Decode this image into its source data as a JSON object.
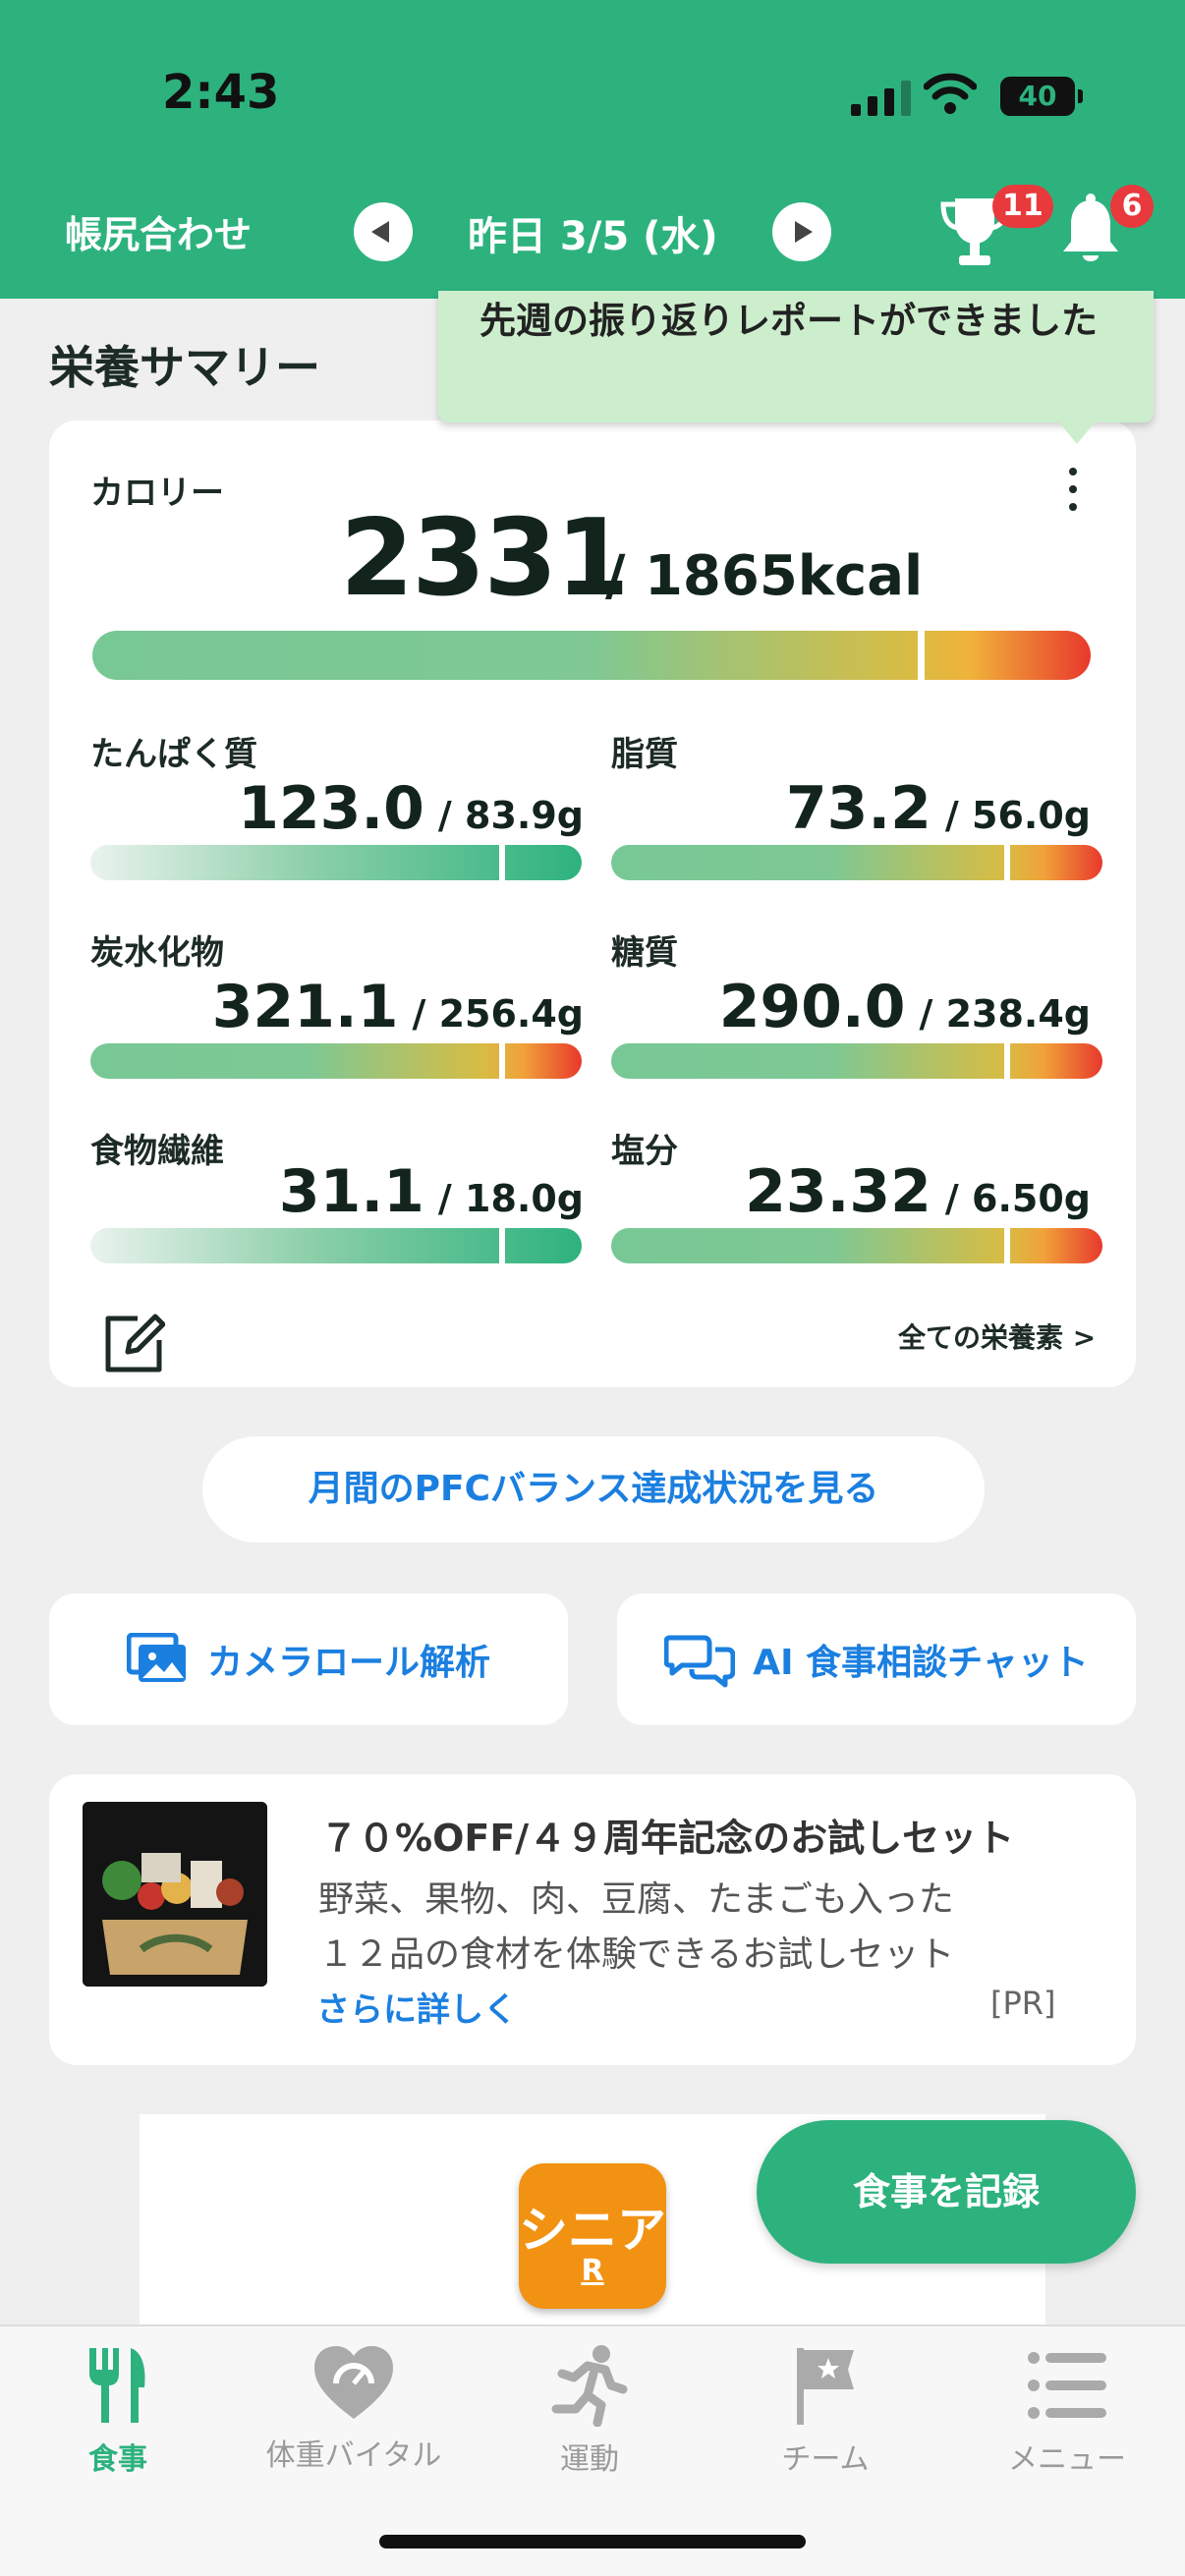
{
  "status_bar": {
    "time": "2:43",
    "battery": "40"
  },
  "header": {
    "left_label": "帳尻合わせ",
    "date": "昨日 3/5 (水)",
    "trophy_badge": "11",
    "bell_badge": "6",
    "bg_color": "#2db27e"
  },
  "tooltip": {
    "text": "先週の振り返りレポートができました"
  },
  "summary": {
    "title": "栄養サマリー",
    "calorie": {
      "label": "カロリー",
      "value": "2331",
      "target": "/ 1865kcal",
      "ratio": 1.25
    },
    "nutrients": [
      {
        "label": "たんぱく質",
        "value": "123.0",
        "target": "/ 83.9g",
        "ratio": 1.47,
        "status": "good"
      },
      {
        "label": "脂質",
        "value": "73.2",
        "target": "/ 56.0g",
        "ratio": 1.31,
        "status": "over"
      },
      {
        "label": "炭水化物",
        "value": "321.1",
        "target": "/ 256.4g",
        "ratio": 1.25,
        "status": "over"
      },
      {
        "label": "糖質",
        "value": "290.0",
        "target": "/ 238.4g",
        "ratio": 1.22,
        "status": "over"
      },
      {
        "label": "食物繊維",
        "value": "31.1",
        "target": "/ 18.0g",
        "ratio": 1.73,
        "status": "good"
      },
      {
        "label": "塩分",
        "value": "23.32",
        "target": "/ 6.50g",
        "ratio": 3.59,
        "status": "over"
      }
    ],
    "all_nutrients_link": "全ての栄養素 >"
  },
  "buttons": {
    "pfc": "月間のPFCバランス達成状況を見る",
    "camera": "カメラロール解析",
    "ai_chat": "AI 食事相談チャット"
  },
  "ad": {
    "title": "７０%OFF/４９周年記念のお試しセット",
    "line1": "野菜、果物、肉、豆腐、たまごも入った",
    "line2": "１２品の食材を体験できるお試しセット",
    "more": "さらに詳しく",
    "pr": "[PR]"
  },
  "senior_app": {
    "line1": "シニア",
    "line2": "R"
  },
  "fab": {
    "label": "食事を記録"
  },
  "tabs": [
    {
      "label": "食事",
      "active": true
    },
    {
      "label": "体重バイタル",
      "active": false
    },
    {
      "label": "運動",
      "active": false
    },
    {
      "label": "チーム",
      "active": false
    },
    {
      "label": "メニュー",
      "active": false
    }
  ],
  "colors": {
    "accent": "#2db27e",
    "link": "#1b7fe0",
    "over": "#e8392c",
    "badge": "#e8393c"
  }
}
